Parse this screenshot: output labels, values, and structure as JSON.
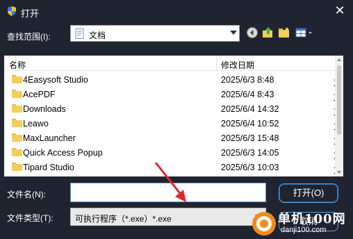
{
  "window": {
    "title": "打开",
    "close_glyph": "✕"
  },
  "lookin": {
    "label": "查找范围(I):",
    "value": "文档"
  },
  "toolbar": {
    "icons": [
      "back-icon",
      "up-folder-icon",
      "new-folder-icon",
      "view-menu-icon"
    ]
  },
  "list": {
    "columns": {
      "name": "名称",
      "date": "修改日期"
    },
    "rows": [
      {
        "name": "4Easysoft Studio",
        "date": "2025/6/3 8:48",
        "type": "文"
      },
      {
        "name": "AcePDF",
        "date": "2025/6/4 8:43",
        "type": "文"
      },
      {
        "name": "Downloads",
        "date": "2025/6/4 14:32",
        "type": "文"
      },
      {
        "name": "Leawo",
        "date": "2025/6/4 10:52",
        "type": "文"
      },
      {
        "name": "MaxLauncher",
        "date": "2025/6/3 15:48",
        "type": "文"
      },
      {
        "name": "Quick Access Popup",
        "date": "2025/6/3 14:05",
        "type": "文"
      },
      {
        "name": "Tipard Studio",
        "date": "2025/6/3 10:03",
        "type": "文"
      }
    ]
  },
  "filename": {
    "label": "文件名(N):",
    "value": ""
  },
  "filetype": {
    "label": "文件类型(T):",
    "value": "可执行程序（*.exe）*.exe"
  },
  "buttons": {
    "open": "打开(O)",
    "cancel": "取消"
  },
  "watermark": {
    "title": "单机100网",
    "url": "danji100.com"
  },
  "colors": {
    "background": "#1f2430",
    "accent": "#5aa0e0",
    "folder": "#f6cd5a",
    "annotation_arrow": "#e0282a"
  }
}
